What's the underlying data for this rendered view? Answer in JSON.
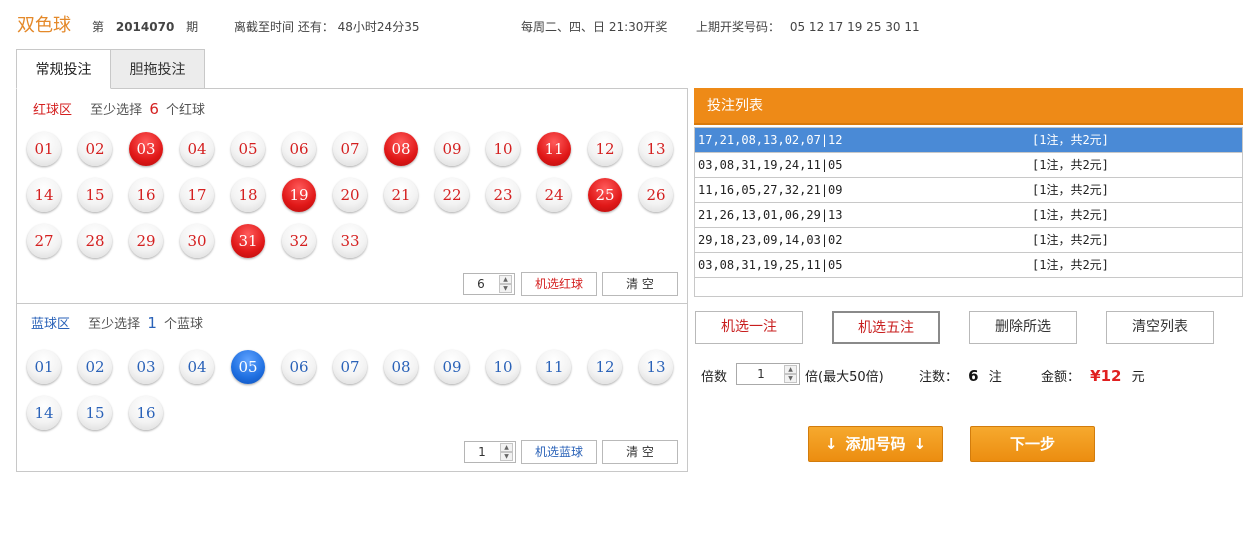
{
  "header": {
    "game_name": "双色球",
    "issue_prefix": "第",
    "issue_no": "2014070",
    "issue_suffix": "期",
    "deadline_label": "离截至时间 还有：",
    "deadline_value": "48小时24分35",
    "schedule": "每周二、四、日 21:30开奖",
    "last_draw_label": "上期开奖号码：",
    "last_draw_numbers": "05 12 17 19 25 30 11"
  },
  "tabs": [
    {
      "label": "常规投注",
      "active": true
    },
    {
      "label": "胆拖投注",
      "active": false
    }
  ],
  "red_zone": {
    "title": "红球区",
    "hint_prefix": "至少选择",
    "min": "6",
    "hint_suffix": "个红球",
    "balls": [
      "01",
      "02",
      "03",
      "04",
      "05",
      "06",
      "07",
      "08",
      "09",
      "10",
      "11",
      "12",
      "13",
      "14",
      "15",
      "16",
      "17",
      "18",
      "19",
      "20",
      "21",
      "22",
      "23",
      "24",
      "25",
      "26",
      "27",
      "28",
      "29",
      "30",
      "31",
      "32",
      "33"
    ],
    "selected": [
      "03",
      "08",
      "11",
      "19",
      "25",
      "31"
    ],
    "random_count": "6",
    "random_label": "机选红球",
    "clear_label": "清 空",
    "accent": "#d42020"
  },
  "blue_zone": {
    "title": "蓝球区",
    "hint_prefix": "至少选择",
    "min": "1",
    "hint_suffix": "个蓝球",
    "balls": [
      "01",
      "02",
      "03",
      "04",
      "05",
      "06",
      "07",
      "08",
      "09",
      "10",
      "11",
      "12",
      "13",
      "14",
      "15",
      "16"
    ],
    "selected": [
      "05"
    ],
    "random_count": "1",
    "random_label": "机选蓝球",
    "clear_label": "清 空",
    "accent": "#2a62b8"
  },
  "bet_list": {
    "title": "投注列表",
    "rows": [
      {
        "numbers": "17,21,08,13,02,07|12",
        "count": "[1注，共2元]",
        "selected": true
      },
      {
        "numbers": "03,08,31,19,24,11|05",
        "count": "[1注，共2元]",
        "selected": false
      },
      {
        "numbers": "11,16,05,27,32,21|09",
        "count": "[1注，共2元]",
        "selected": false
      },
      {
        "numbers": "21,26,13,01,06,29|13",
        "count": "[1注，共2元]",
        "selected": false
      },
      {
        "numbers": "29,18,23,09,14,03|02",
        "count": "[1注，共2元]",
        "selected": false
      },
      {
        "numbers": "03,08,31,19,25,11|05",
        "count": "[1注，共2元]",
        "selected": false
      }
    ]
  },
  "actions": {
    "random_one": "机选一注",
    "random_five": "机选五注",
    "delete_selected": "删除所选",
    "clear_list": "清空列表"
  },
  "summary": {
    "multiplier_label": "倍数",
    "multiplier_value": "1",
    "multiplier_suffix": "倍(最大50倍)",
    "bets_label": "注数：",
    "bets_value": "6",
    "bets_unit": "注",
    "amount_label": "金额：",
    "amount_value": "¥12",
    "amount_unit": "元"
  },
  "buttons": {
    "add_numbers": "添加号码",
    "next_step": "下一步",
    "arrow_icon": "↓",
    "primary_color": "#ee8a17"
  }
}
